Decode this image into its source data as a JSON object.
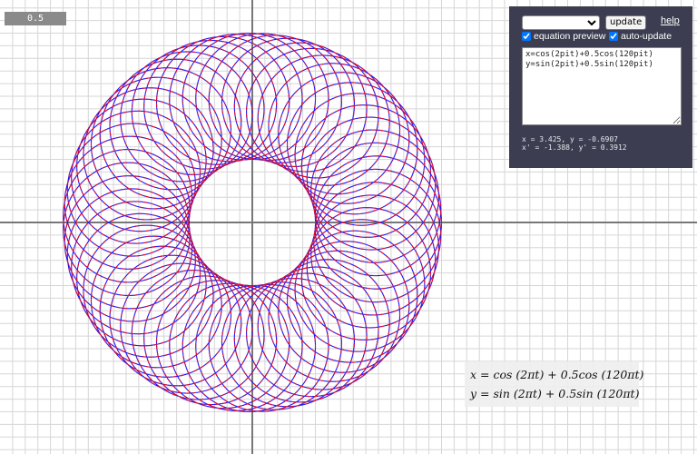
{
  "app": {
    "zoom_label": "0.5"
  },
  "controls": {
    "preset_selected": "",
    "update_label": "update",
    "help_label": "help",
    "equation_preview_label": "equation preview",
    "equation_preview_checked": true,
    "auto_update_label": "auto-update",
    "auto_update_checked": true,
    "equations_text": "x=cos(2pit)+0.5cos(120pit)\ny=sin(2pit)+0.5sin(120pit)",
    "coord_line1": "x = 3.425, y = -0.6907",
    "coord_line2": "x' = -1.388, y' = 0.3912"
  },
  "preview": {
    "x_equation": "x = cos (2πt) + 0.5cos (120πt)",
    "y_equation": "y = sin (2πt) + 0.5sin (120πt)"
  },
  "colors": {
    "curve_primary": "#1a1aff",
    "curve_secondary": "#e0102a",
    "grid_minor": "#d6d6d6",
    "axis": "#777777",
    "panel_bg": "#3d3d52"
  }
}
